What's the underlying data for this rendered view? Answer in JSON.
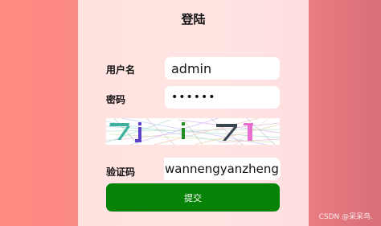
{
  "form": {
    "title": "登陆",
    "username_label": "用户名",
    "username_value": "admin",
    "password_label": "密码",
    "password_value": "••••••",
    "captcha_label": "验证码",
    "captcha_value": "wannengyanzheng",
    "submit_label": "提交"
  },
  "colors": {
    "submit_bg": "#068206",
    "panel_bg": "#ffe3df",
    "background_left": "#ff8a80",
    "background_right": "#d86f79"
  },
  "watermark": "CSDN @呆呆鸟."
}
